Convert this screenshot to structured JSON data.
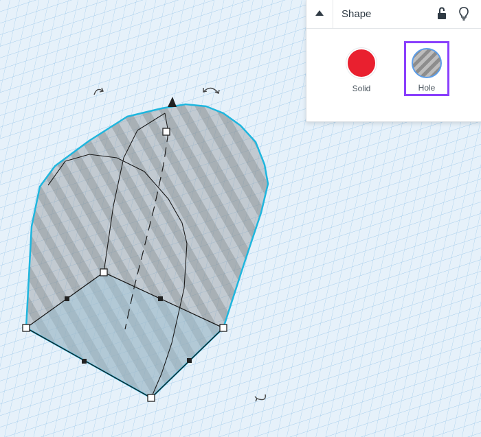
{
  "inspector": {
    "title": "Shape",
    "collapse_icon": "triangle-up-icon",
    "lock_icon": "unlock-icon",
    "bulb_icon": "lightbulb-icon",
    "options": [
      {
        "label": "Solid",
        "color": "#e9202f",
        "selected": false
      },
      {
        "label": "Hole",
        "pattern": "gray-diagonal-stripes",
        "selected": true
      }
    ],
    "selection_color": "#8a3ffc"
  },
  "canvas": {
    "shape_outline_color": "#1fb6de",
    "handles": [
      "rotate-handle-left",
      "rotate-handle-right",
      "rotate-handle-bottom",
      "height-cone"
    ]
  }
}
